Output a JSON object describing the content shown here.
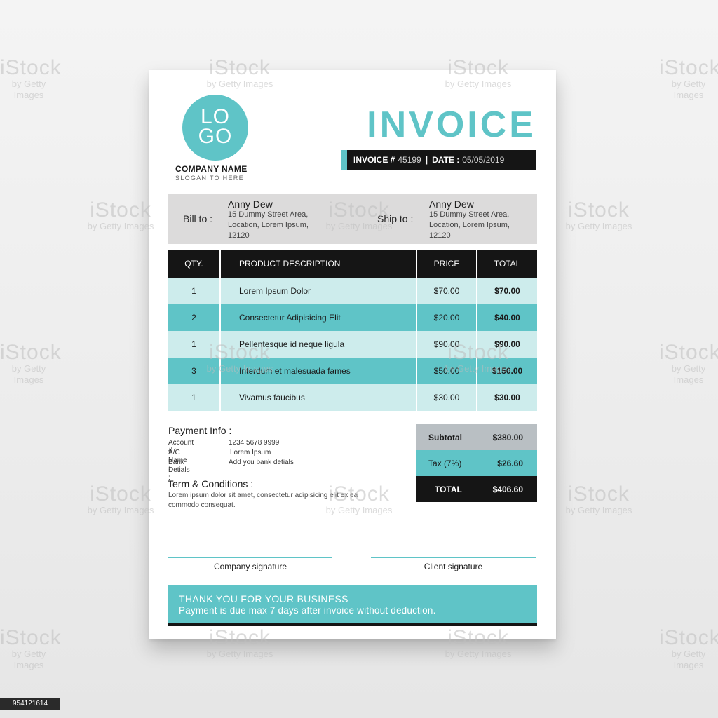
{
  "header": {
    "logo_line1": "LO",
    "logo_line2": "GO",
    "company_name": "COMPANY NAME",
    "slogan": "SLOGAN TO HERE",
    "title": "INVOICE",
    "invoice_label": "INVOICE #",
    "invoice_number": "45199",
    "date_label": "DATE :",
    "date_value": "05/05/2019"
  },
  "billing": {
    "bill_label": "Bill to :",
    "bill_name": "Anny Dew",
    "bill_address": "15 Dummy Street Area, Location, Lorem Ipsum, 12120",
    "ship_label": "Ship to :",
    "ship_name": "Anny Dew",
    "ship_address": "15 Dummy Street Area, Location, Lorem Ipsum, 12120"
  },
  "table": {
    "headers": {
      "qty": "QTY.",
      "desc": "PRODUCT DESCRIPTION",
      "price": "PRICE",
      "total": "TOTAL"
    },
    "rows": [
      {
        "qty": "1",
        "desc": "Lorem Ipsum Dolor",
        "price": "$70.00",
        "total": "$70.00"
      },
      {
        "qty": "2",
        "desc": "Consectetur Adipisicing Elit",
        "price": "$20.00",
        "total": "$40.00"
      },
      {
        "qty": "1",
        "desc": "Pellentesque id neque ligula",
        "price": "$90.00",
        "total": "$90.00"
      },
      {
        "qty": "3",
        "desc": "Interdum et malesuada fames",
        "price": "$50.00",
        "total": "$150.00"
      },
      {
        "qty": "1",
        "desc": "Vivamus faucibus",
        "price": "$30.00",
        "total": "$30.00"
      }
    ]
  },
  "payment": {
    "title": "Payment Info :",
    "account_label": "Account # :",
    "account_value": "1234 5678 9999",
    "ac_name_label": "A/C Name :",
    "ac_name_value": "Lorem Ipsum",
    "bank_label": "Bank Detials :",
    "bank_value": "Add you bank detials"
  },
  "terms": {
    "title": "Term & Conditions :",
    "text": "Lorem ipsum dolor sit amet, consectetur adipisicing elit ex ea commodo consequat."
  },
  "summary": {
    "subtotal_label": "Subtotal",
    "subtotal_value": "$380.00",
    "tax_label": "Tax (7%)",
    "tax_value": "$26.60",
    "total_label": "TOTAL",
    "total_value": "$406.60"
  },
  "signatures": {
    "company": "Company signature",
    "client": "Client signature"
  },
  "footer": {
    "line1": "THANK YOU FOR YOUR BUSINESS",
    "line2": "Payment is due max 7 days after invoice without deduction."
  },
  "watermark": {
    "brand": "iStock",
    "credit": "by Getty Images"
  },
  "image_id": "954121614",
  "colors": {
    "accent": "#5fc4c7",
    "accent_light": "#cdecec",
    "dark": "#151515",
    "bill_box": "#dcdbdb",
    "subtotal_bg": "#b9bfc3"
  }
}
